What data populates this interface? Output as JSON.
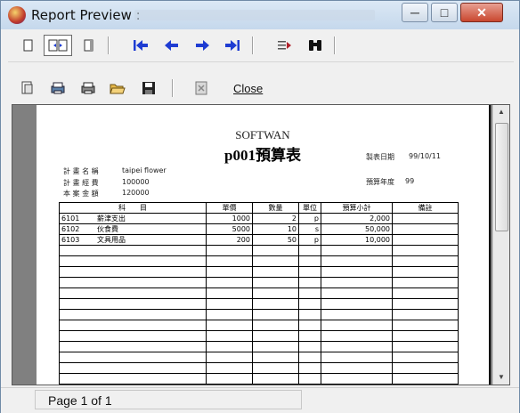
{
  "window": {
    "title": "Report Preview :",
    "controls": {
      "minimize": "─",
      "maximize": "□",
      "close": "✕"
    }
  },
  "toolbar_nav": {
    "buttons": [
      "single-page-icon",
      "two-page-icon",
      "fit-page-icon",
      "first-page-icon",
      "prev-page-icon",
      "next-page-icon",
      "last-page-icon",
      "goto-page-icon",
      "find-icon"
    ],
    "accent_color": "#1e3cd2"
  },
  "toolbar_file": {
    "buttons": [
      "page-setup-icon",
      "print-setup-icon",
      "print-icon",
      "open-icon",
      "save-icon",
      "export-icon"
    ],
    "close_label": "Close"
  },
  "report": {
    "company": "SOFTWAN",
    "title": "p001預算表",
    "print_date_label": "製表日期",
    "print_date": "99/10/11",
    "budget_year_label": "預算年度",
    "budget_year": "99",
    "plan_name_label": "計 畫 名 稱",
    "plan_name": "taipei flower",
    "plan_budget_label": "計 畫 經 費",
    "plan_budget": "100000",
    "current_amount_label": "本 案 金 額",
    "current_amount": "120000",
    "columns": [
      "科　　目",
      "單價",
      "數量",
      "單位",
      "預算小計",
      "備註"
    ],
    "rows": [
      {
        "code": "6101",
        "name": "薪津支出",
        "price": "1000",
        "qty": "2",
        "unit": "p",
        "subtotal": "2,000",
        "note": ""
      },
      {
        "code": "6102",
        "name": "伙食費",
        "price": "5000",
        "qty": "10",
        "unit": "s",
        "subtotal": "50,000",
        "note": ""
      },
      {
        "code": "6103",
        "name": "文具用品",
        "price": "200",
        "qty": "50",
        "unit": "p",
        "subtotal": "10,000",
        "note": ""
      }
    ]
  },
  "status": {
    "page": "Page 1 of 1"
  }
}
